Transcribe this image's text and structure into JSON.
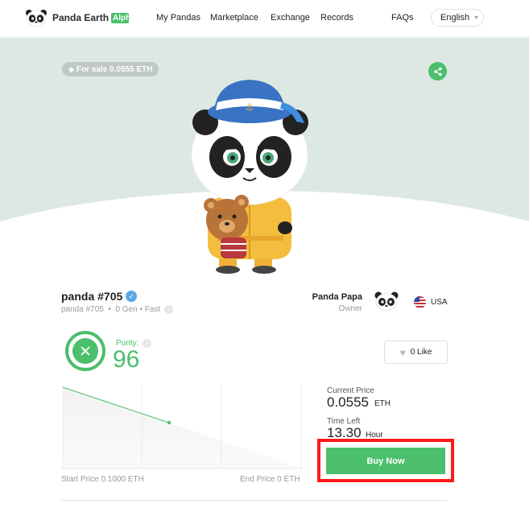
{
  "header": {
    "brand": "Panda Earth",
    "badge": "Alph",
    "nav": [
      "My Pandas",
      "Marketplace",
      "Exchange",
      "Records",
      "FAQs"
    ],
    "language": "English"
  },
  "hero": {
    "sale_tag": "For sale 0.0555 ETH"
  },
  "panda": {
    "name": "panda #705",
    "subtitle": "panda #705  •  0 Gen • Fast",
    "purity_label": "Purity:",
    "purity_value": "96"
  },
  "owner": {
    "name": "Panda Papa",
    "role": "Owner",
    "country": "USA"
  },
  "like": {
    "label": "0 Like"
  },
  "price": {
    "current_label": "Current Price",
    "current_value": "0.0555",
    "current_unit": "ETH",
    "time_label": "Time Left",
    "time_value": "13.30",
    "time_unit": "Hour",
    "buy_label": "Buy Now",
    "start_price": "Start Price 0.1000 ETH",
    "end_price": "End Price 0 ETH"
  },
  "colors": {
    "accent": "#4bbf6b",
    "hero_bg": "#dde8e2",
    "highlight": "#ff1a1a"
  },
  "icons": [
    "panda-logo-icon",
    "tag-icon",
    "share-icon",
    "verified-icon",
    "info-icon",
    "dna-icon",
    "heart-icon",
    "us-flag-icon",
    "chevron-down-icon"
  ]
}
